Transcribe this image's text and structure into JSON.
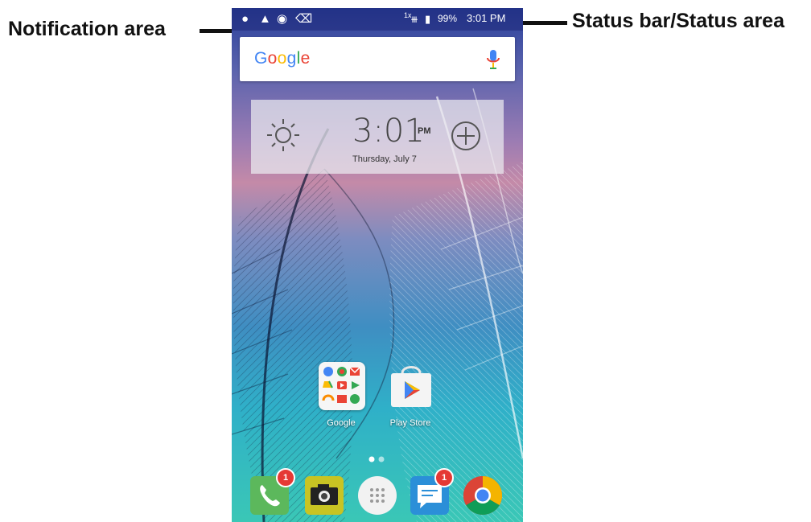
{
  "callouts": {
    "left": "Notification area",
    "right": "Status bar/Status area"
  },
  "status_bar": {
    "notification_icons": [
      "message-icon",
      "upload-icon",
      "chat-icon",
      "alarm-icon"
    ],
    "signal_label": "1x",
    "battery_text": "99%",
    "time": "3:01 PM"
  },
  "search": {
    "logo": "Google",
    "mic_icon": "mic-icon"
  },
  "clock_widget": {
    "time": "3:01",
    "ampm": "PM",
    "date": "Thursday, July 7",
    "weather_icon": "sun-icon",
    "add_icon": "plus-icon"
  },
  "home_apps": [
    {
      "label": "Google",
      "icon": "google-folder-icon"
    },
    {
      "label": "Play Store",
      "icon": "play-store-icon"
    }
  ],
  "dock": [
    {
      "name": "phone",
      "icon": "phone-icon",
      "badge": "1",
      "color": "#5cb85c"
    },
    {
      "name": "camera",
      "icon": "camera-icon",
      "badge": "",
      "color": "#c8c423"
    },
    {
      "name": "app-drawer",
      "icon": "apps-grid-icon",
      "badge": "",
      "color": "#f2f2f2"
    },
    {
      "name": "messaging",
      "icon": "message-icon",
      "badge": "1",
      "color": "#2b8fd8"
    },
    {
      "name": "chrome",
      "icon": "chrome-icon",
      "badge": "",
      "color": "#db4437"
    }
  ],
  "colors": {
    "badge": "#e53935",
    "google_blue": "#4285F4",
    "google_red": "#EA4335",
    "google_yellow": "#FBBC05",
    "google_green": "#34A853"
  }
}
